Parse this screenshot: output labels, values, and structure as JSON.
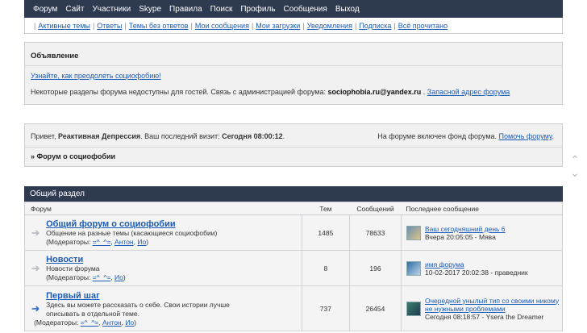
{
  "topnav": [
    "Форум",
    "Сайт",
    "Участники",
    "Skype",
    "Правила",
    "Поиск",
    "Профиль",
    "Сообщения",
    "Выход"
  ],
  "subnav": [
    "Активные темы",
    "Ответы",
    "Темы без ответов",
    "Мои сообщения",
    "Мои загрузки",
    "Уведомления",
    "Подписка",
    "Всё прочитано"
  ],
  "announcement": {
    "title": "Объявление",
    "link": "Узнайте, как преодолеть социофобию!",
    "text": "Некоторые разделы форума недоступны для гостей. Связь с администрацией форума: ",
    "email": "sociophobia.ru@yandex.ru",
    "dot": " . ",
    "alt_link": "Запасной адрес форума"
  },
  "welcome": {
    "greet_prefix": "Привет, ",
    "username": "Реактивная Депрессия",
    "visit_prefix": ". Ваш последний визит: ",
    "visit_time": "Сегодня 08:00:12",
    "visit_suffix": ".",
    "fund_text": "На форуме включен фонд форума. ",
    "fund_link": "Помочь форуму",
    "fund_suffix": ".",
    "breadcrumb": "» Форум о социофобии"
  },
  "section": {
    "title": "Общий раздел",
    "columns": {
      "forum": "Форум",
      "topics": "Тем",
      "posts": "Сообщений",
      "last": "Последнее сообщение"
    },
    "forums": [
      {
        "title": "Общий форум о социофобии",
        "desc": "Общение на разные темы (касающиеся социофобии)",
        "mods_label": "(Модераторы: ",
        "mods": [
          "=^_^=",
          "Антон",
          "Ио"
        ],
        "mods_end": ")",
        "topics": "1485",
        "posts": "78633",
        "last_title": "Ваш сегодняшний день 6",
        "last_meta": "Вчера 20:05:05 - Мява",
        "icon": "read-arrow-icon"
      },
      {
        "title": "Новости",
        "desc": "Новости форума",
        "mods_label": "(Модераторы: ",
        "mods": [
          "=^_^=",
          "Ио"
        ],
        "mods_end": ")",
        "topics": "8",
        "posts": "196",
        "last_title": "имя форума",
        "last_meta": "10-02-2017 20:02:38 - праведник",
        "icon": "read-arrow-icon"
      },
      {
        "title": "Первый шаг",
        "desc": "Здесь вы можете рассказать о себе. Свои истории лучше описывать в отдельной теме.",
        "mods_label": "(Модераторы: ",
        "mods": [
          "=^_^=",
          "Антон",
          "Ио"
        ],
        "mods_end": ")",
        "topics": "737",
        "posts": "26454",
        "last_title": "Очередной унылый тип со своими никому не нужными проблемами",
        "last_meta": "Сегодня 08:18:57 - Ysera the Dreamer",
        "icon": "new-posts-arrow-icon"
      }
    ]
  }
}
